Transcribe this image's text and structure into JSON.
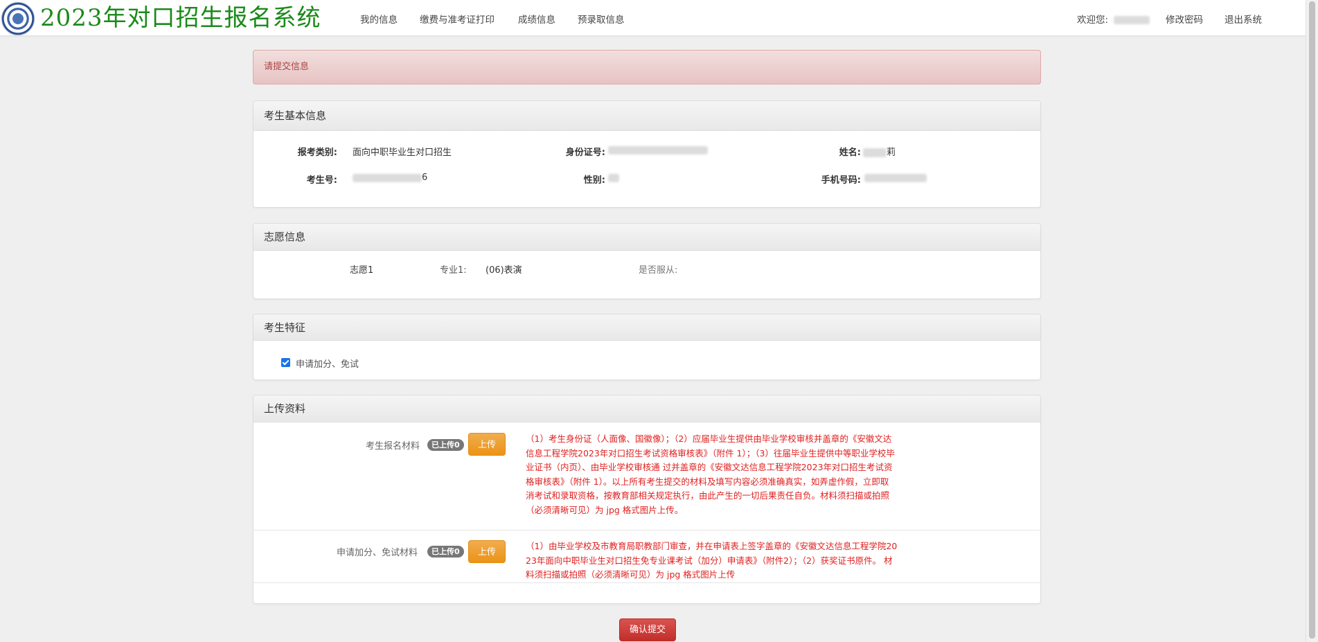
{
  "header": {
    "brand": "2023年对口招生报名系统",
    "nav": {
      "my_info": "我的信息",
      "payment_print": "缴费与准考证打印",
      "scores": "成绩信息",
      "pre_admission": "预录取信息"
    },
    "welcome_label": "欢迎您:",
    "change_password": "修改密码",
    "logout": "退出系统"
  },
  "alert": {
    "message": "请提交信息"
  },
  "basic_info": {
    "title": "考生基本信息",
    "category_label": "报考类别:",
    "category_value": "面向中职毕业生对口招生",
    "id_label": "身份证号:",
    "name_label": "姓名:",
    "name_suffix": "莉",
    "exam_no_label": "考生号:",
    "exam_no_suffix": "6",
    "gender_label": "性别:",
    "phone_label": "手机号码:"
  },
  "preference": {
    "title": "志愿信息",
    "choice_label": "志愿1",
    "major_label": "专业1:",
    "major_value": "(06)表演",
    "obey_label": "是否服从:"
  },
  "features": {
    "title": "考生特征",
    "checkbox_label": "申请加分、免试",
    "checked": true
  },
  "upload": {
    "title": "上传资料",
    "rows": [
      {
        "label": "考生报名材料",
        "badge": "已上传0",
        "button": "上传",
        "note": "（1）考生身份证（人面像、国徽像）；（2）应届毕业生提供由毕业学校审核并盖章的《安徽文达信息工程学院2023年对口招生考试资格审核表》（附件 1）；（3）往届毕业生提供中等职业学校毕业证书（内页）、由毕业学校审核通 过并盖章的《安徽文达信息工程学院2023年对口招生考试资格审核表》（附件 1）。以上所有考生提交的材料及填写内容必须准确真实，如弄虚作假，立即取 消考试和录取资格，按教育部相关规定执行，由此产生的一切后果责任自负。材料须扫描或拍照（必须清晰可见）为 jpg 格式图片上传。"
      },
      {
        "label": "申请加分、免试材料",
        "badge": "已上传0",
        "button": "上传",
        "note": "（1）由毕业学校及市教育局职教部门审查，并在申请表上签字盖章的《安徽文达信息工程学院2023年面向中职毕业生对口招生免专业课考试（加分）申请表》（附件2）；（2）获奖证书原件。 材料须扫描或拍照（必须清晰可见）为 jpg 格式图片上传"
      }
    ]
  },
  "submit": {
    "label": "确认提交"
  },
  "colors": {
    "brand_green": "#1a8a1a",
    "alert_text": "#a94442",
    "note_red": "#e02020",
    "warning_orange": "#f0ad4e",
    "danger_red": "#d9534f"
  }
}
